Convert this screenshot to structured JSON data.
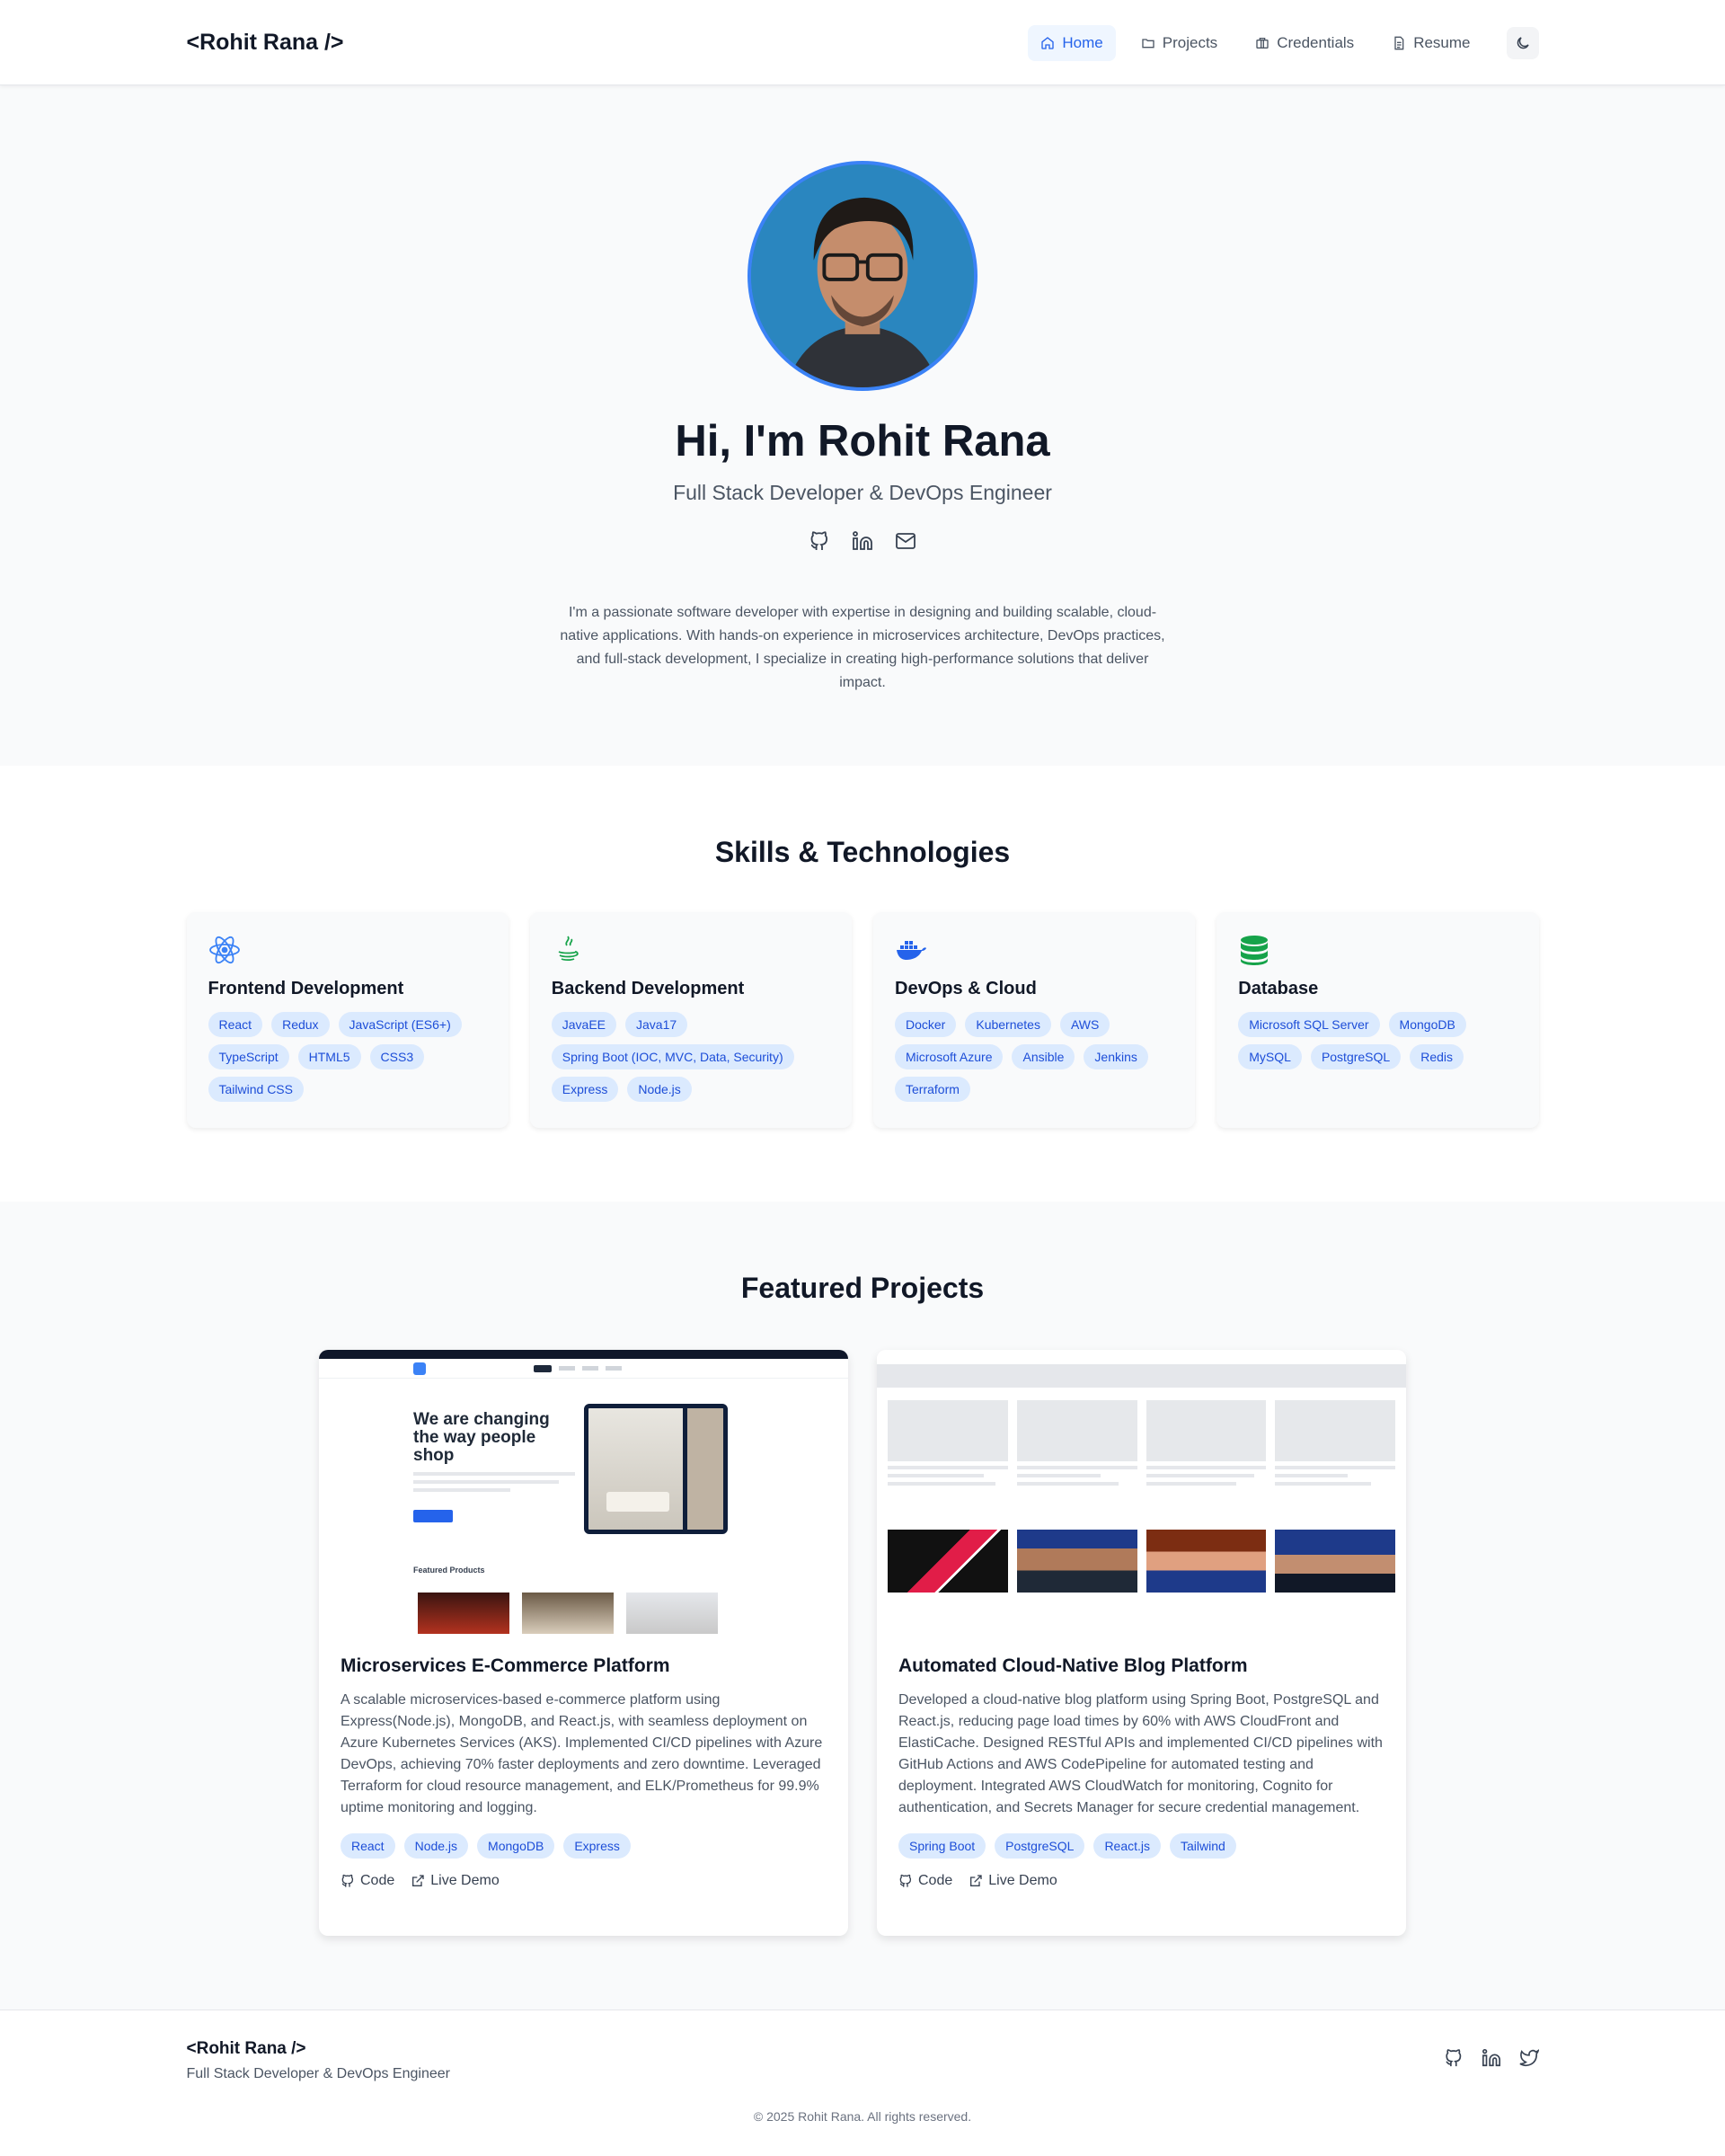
{
  "nav": {
    "brand": "<Rohit Rana />",
    "links": [
      {
        "label": "Home",
        "icon": "home-icon",
        "active": true
      },
      {
        "label": "Projects",
        "icon": "folder-icon",
        "active": false
      },
      {
        "label": "Credentials",
        "icon": "briefcase-icon",
        "active": false
      },
      {
        "label": "Resume",
        "icon": "file-icon",
        "active": false
      }
    ],
    "theme_icon": "moon-icon"
  },
  "hero": {
    "greeting": "Hi, I'm Rohit Rana",
    "subtitle": "Full Stack Developer & DevOps Engineer",
    "social": [
      "github-icon",
      "linkedin-icon",
      "mail-icon"
    ],
    "bio": "I'm a passionate software developer with expertise in designing and building scalable, cloud-native applications. With hands-on experience in microservices architecture, DevOps practices, and full-stack development, I specialize in creating high-performance solutions that deliver impact."
  },
  "skills": {
    "title": "Skills & Technologies",
    "cards": [
      {
        "title": "Frontend Development",
        "icon": "react-icon",
        "tags": [
          "React",
          "Redux",
          "JavaScript (ES6+)",
          "TypeScript",
          "HTML5",
          "CSS3",
          "Tailwind CSS"
        ]
      },
      {
        "title": "Backend Development",
        "icon": "java-icon",
        "tags": [
          "JavaEE",
          "Java17",
          "Spring Boot (IOC, MVC, Data, Security)",
          "Express",
          "Node.js"
        ]
      },
      {
        "title": "DevOps & Cloud",
        "icon": "docker-icon",
        "tags": [
          "Docker",
          "Kubernetes",
          "AWS",
          "Microsoft Azure",
          "Ansible",
          "Jenkins",
          "Terraform"
        ]
      },
      {
        "title": "Database",
        "icon": "database-icon",
        "tags": [
          "Microsoft SQL Server",
          "MongoDB",
          "MySQL",
          "PostgreSQL",
          "Redis"
        ]
      }
    ]
  },
  "projects": {
    "title": "Featured Projects",
    "cards": [
      {
        "title": "Microservices E-Commerce Platform",
        "description": "A scalable microservices-based e-commerce platform using Express(Node.js), MongoDB, and React.js, with seamless deployment on Azure Kubernetes Services (AKS). Implemented CI/CD pipelines with Azure DevOps, achieving 70% faster deployments and zero downtime. Leveraged Terraform for cloud resource management, and ELK/Prometheus for 99.9% uptime monitoring and logging.",
        "tags": [
          "React",
          "Node.js",
          "MongoDB",
          "Express"
        ],
        "code_label": "Code",
        "demo_label": "Live Demo",
        "screenshot": {
          "hero_title": "We are changing the way people shop",
          "section": "Featured Products"
        }
      },
      {
        "title": "Automated Cloud-Native Blog Platform",
        "description": "Developed a cloud-native blog platform using Spring Boot, PostgreSQL and React.js, reducing page load times by 60% with AWS CloudFront and ElastiCache. Designed RESTful APIs and implemented CI/CD pipelines with GitHub Actions and AWS CodePipeline for automated testing and deployment. Integrated AWS CloudWatch for monitoring, Cognito for authentication, and Secrets Manager for secure credential management.",
        "tags": [
          "Spring Boot",
          "PostgreSQL",
          "React.js",
          "Tailwind"
        ],
        "code_label": "Code",
        "demo_label": "Live Demo"
      }
    ]
  },
  "footer": {
    "brand": "<Rohit Rana />",
    "subtitle": "Full Stack Developer & DevOps Engineer",
    "social": [
      "github-icon",
      "linkedin-icon",
      "twitter-icon"
    ],
    "copyright": "© 2025 Rohit Rana. All rights reserved."
  },
  "colors": {
    "accent": "#2563eb",
    "tag_bg": "#dbeafe",
    "tag_text": "#1d4ed8",
    "avatar_ring": "#3b82f6"
  }
}
